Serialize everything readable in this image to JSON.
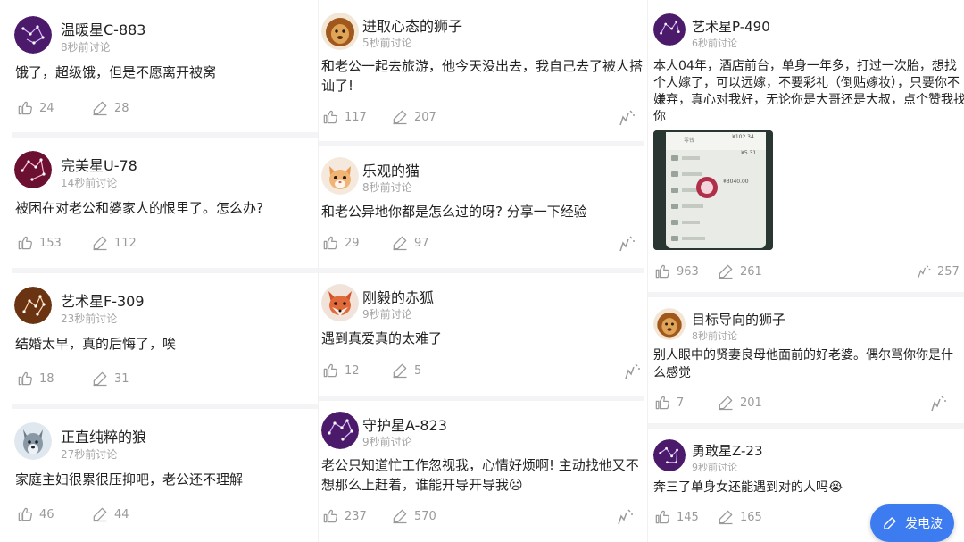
{
  "columns": [
    {
      "posts": [
        {
          "avatar": "constellation-purple",
          "name": "温暖星C-883",
          "time": "8秒前讨论",
          "lines": [
            "饿了，超级饿，但是不愿离开被窝"
          ],
          "likes": "24",
          "comments": "28"
        },
        {
          "avatar": "constellation-red",
          "name": "完美星U-78",
          "time": "14秒前讨论",
          "lines": [
            "被困在对老公和婆家人的恨里了。怎么办?"
          ],
          "likes": "153",
          "comments": "112"
        },
        {
          "avatar": "constellation-brown",
          "name": "艺术星F-309",
          "time": "23秒前讨论",
          "lines": [
            "结婚太早，真的后悔了，唉"
          ],
          "likes": "18",
          "comments": "31"
        },
        {
          "avatar": "wolf",
          "name": "正直纯粹的狼",
          "time": "27秒前讨论",
          "lines": [
            "家庭主妇很累很压抑吧，老公还不理解"
          ],
          "likes": "46",
          "comments": "44"
        }
      ]
    },
    {
      "posts": [
        {
          "avatar": "lion",
          "name": "进取心态的狮子",
          "time": "5秒前讨论",
          "lines": [
            "和老公一起去旅游，他今天没出去，我自己去了被人搭",
            "讪了!"
          ],
          "likes": "117",
          "comments": "207"
        },
        {
          "avatar": "cat",
          "name": "乐观的猫",
          "time": "8秒前讨论",
          "lines": [
            "和老公异地你都是怎么过的呀? 分享一下经验"
          ],
          "likes": "29",
          "comments": "97"
        },
        {
          "avatar": "fox",
          "name": "刚毅的赤狐",
          "time": "9秒前讨论",
          "lines": [
            "遇到真爱真的太难了"
          ],
          "likes": "12",
          "comments": "5"
        },
        {
          "avatar": "constellation-purple",
          "name": "守护星A-823",
          "time": "9秒前讨论",
          "lines": [
            "老公只知道忙工作忽视我，心情好烦啊! 主动找他又不",
            "想那么上赶着，谁能开导开导我☹"
          ],
          "likes": "237",
          "comments": "570"
        }
      ]
    },
    {
      "posts": [
        {
          "avatar": "constellation-purple",
          "name": "艺术星P-490",
          "time": "6秒前讨论",
          "lines": [
            "本人04年，酒店前台，单身一年多，打过一次胎，想找",
            "个人嫁了，可以远嫁，不要彩礼（倒贴嫁妆），只要你不",
            "嫌弃，真心对我好，无论你是大哥还是大叔，点个赞我找",
            "你"
          ],
          "likes": "963",
          "comments": "261",
          "sparks": "257"
        },
        {
          "avatar": "lion",
          "name": "目标导向的狮子",
          "time": "8秒前讨论",
          "lines": [
            "别人眼中的贤妻良母他面前的好老婆。偶尔骂你你是什",
            "么感觉"
          ],
          "likes": "7",
          "comments": "201"
        },
        {
          "avatar": "constellation-purple",
          "name": "勇敢星Z-23",
          "time": "9秒前讨论",
          "lines": [
            "奔三了单身女还能遇到对的人吗😭"
          ],
          "likes": "145",
          "comments": "165"
        }
      ]
    }
  ],
  "screenshot_texts": [
    "零钱",
    "¥102.34",
    "¥5.31",
    "¥3040.00"
  ],
  "fab": {
    "label": "发电波"
  },
  "colors": {
    "accent": "#3d7cf0",
    "muted": "#9a9a9a"
  }
}
